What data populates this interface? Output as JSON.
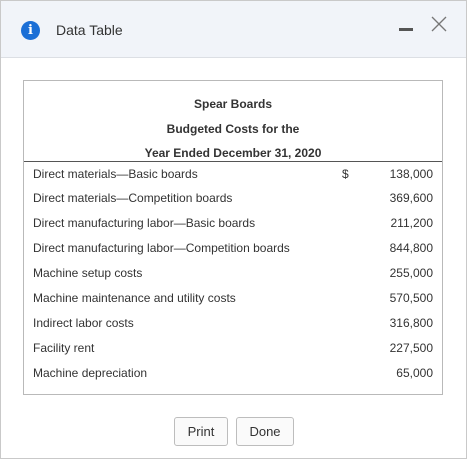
{
  "window": {
    "title": "Data Table"
  },
  "table": {
    "company": "Spear Boards",
    "report": "Budgeted Costs for the",
    "period": "Year Ended December 31, 2020",
    "currency_symbol": "$",
    "rows": [
      {
        "label": "Direct materials—Basic boards",
        "value": "138,000"
      },
      {
        "label": "Direct materials—Competition boards",
        "value": "369,600"
      },
      {
        "label": "Direct manufacturing labor—Basic boards",
        "value": "211,200"
      },
      {
        "label": "Direct manufacturing labor—Competition boards",
        "value": "844,800"
      },
      {
        "label": "Machine setup costs",
        "value": "255,000"
      },
      {
        "label": "Machine maintenance and utility costs",
        "value": "570,500"
      },
      {
        "label": "Indirect labor costs",
        "value": "316,800"
      },
      {
        "label": "Facility rent",
        "value": "227,500"
      },
      {
        "label": "Machine depreciation",
        "value": "65,000"
      }
    ]
  },
  "buttons": {
    "print": "Print",
    "done": "Done"
  },
  "icons": {
    "info": "info-icon",
    "minimize": "minimize-icon",
    "close": "close-icon"
  },
  "colors": {
    "accent": "#1b6fd6",
    "titlebar": "#f1f4f9"
  }
}
